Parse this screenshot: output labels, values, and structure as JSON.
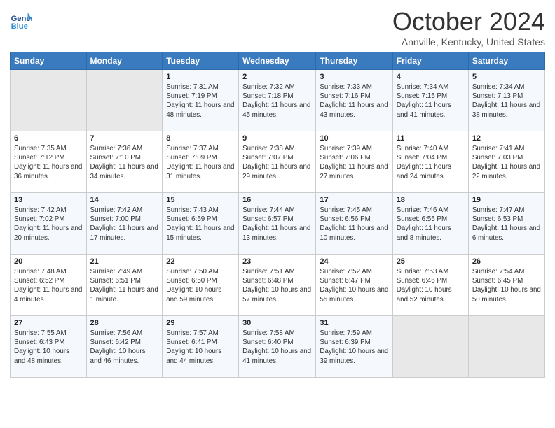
{
  "header": {
    "logo_line1": "General",
    "logo_line2": "Blue",
    "month": "October 2024",
    "location": "Annville, Kentucky, United States"
  },
  "days_of_week": [
    "Sunday",
    "Monday",
    "Tuesday",
    "Wednesday",
    "Thursday",
    "Friday",
    "Saturday"
  ],
  "weeks": [
    [
      {
        "day": "",
        "detail": ""
      },
      {
        "day": "",
        "detail": ""
      },
      {
        "day": "1",
        "detail": "Sunrise: 7:31 AM\nSunset: 7:19 PM\nDaylight: 11 hours and 48 minutes."
      },
      {
        "day": "2",
        "detail": "Sunrise: 7:32 AM\nSunset: 7:18 PM\nDaylight: 11 hours and 45 minutes."
      },
      {
        "day": "3",
        "detail": "Sunrise: 7:33 AM\nSunset: 7:16 PM\nDaylight: 11 hours and 43 minutes."
      },
      {
        "day": "4",
        "detail": "Sunrise: 7:34 AM\nSunset: 7:15 PM\nDaylight: 11 hours and 41 minutes."
      },
      {
        "day": "5",
        "detail": "Sunrise: 7:34 AM\nSunset: 7:13 PM\nDaylight: 11 hours and 38 minutes."
      }
    ],
    [
      {
        "day": "6",
        "detail": "Sunrise: 7:35 AM\nSunset: 7:12 PM\nDaylight: 11 hours and 36 minutes."
      },
      {
        "day": "7",
        "detail": "Sunrise: 7:36 AM\nSunset: 7:10 PM\nDaylight: 11 hours and 34 minutes."
      },
      {
        "day": "8",
        "detail": "Sunrise: 7:37 AM\nSunset: 7:09 PM\nDaylight: 11 hours and 31 minutes."
      },
      {
        "day": "9",
        "detail": "Sunrise: 7:38 AM\nSunset: 7:07 PM\nDaylight: 11 hours and 29 minutes."
      },
      {
        "day": "10",
        "detail": "Sunrise: 7:39 AM\nSunset: 7:06 PM\nDaylight: 11 hours and 27 minutes."
      },
      {
        "day": "11",
        "detail": "Sunrise: 7:40 AM\nSunset: 7:04 PM\nDaylight: 11 hours and 24 minutes."
      },
      {
        "day": "12",
        "detail": "Sunrise: 7:41 AM\nSunset: 7:03 PM\nDaylight: 11 hours and 22 minutes."
      }
    ],
    [
      {
        "day": "13",
        "detail": "Sunrise: 7:42 AM\nSunset: 7:02 PM\nDaylight: 11 hours and 20 minutes."
      },
      {
        "day": "14",
        "detail": "Sunrise: 7:42 AM\nSunset: 7:00 PM\nDaylight: 11 hours and 17 minutes."
      },
      {
        "day": "15",
        "detail": "Sunrise: 7:43 AM\nSunset: 6:59 PM\nDaylight: 11 hours and 15 minutes."
      },
      {
        "day": "16",
        "detail": "Sunrise: 7:44 AM\nSunset: 6:57 PM\nDaylight: 11 hours and 13 minutes."
      },
      {
        "day": "17",
        "detail": "Sunrise: 7:45 AM\nSunset: 6:56 PM\nDaylight: 11 hours and 10 minutes."
      },
      {
        "day": "18",
        "detail": "Sunrise: 7:46 AM\nSunset: 6:55 PM\nDaylight: 11 hours and 8 minutes."
      },
      {
        "day": "19",
        "detail": "Sunrise: 7:47 AM\nSunset: 6:53 PM\nDaylight: 11 hours and 6 minutes."
      }
    ],
    [
      {
        "day": "20",
        "detail": "Sunrise: 7:48 AM\nSunset: 6:52 PM\nDaylight: 11 hours and 4 minutes."
      },
      {
        "day": "21",
        "detail": "Sunrise: 7:49 AM\nSunset: 6:51 PM\nDaylight: 11 hours and 1 minute."
      },
      {
        "day": "22",
        "detail": "Sunrise: 7:50 AM\nSunset: 6:50 PM\nDaylight: 10 hours and 59 minutes."
      },
      {
        "day": "23",
        "detail": "Sunrise: 7:51 AM\nSunset: 6:48 PM\nDaylight: 10 hours and 57 minutes."
      },
      {
        "day": "24",
        "detail": "Sunrise: 7:52 AM\nSunset: 6:47 PM\nDaylight: 10 hours and 55 minutes."
      },
      {
        "day": "25",
        "detail": "Sunrise: 7:53 AM\nSunset: 6:46 PM\nDaylight: 10 hours and 52 minutes."
      },
      {
        "day": "26",
        "detail": "Sunrise: 7:54 AM\nSunset: 6:45 PM\nDaylight: 10 hours and 50 minutes."
      }
    ],
    [
      {
        "day": "27",
        "detail": "Sunrise: 7:55 AM\nSunset: 6:43 PM\nDaylight: 10 hours and 48 minutes."
      },
      {
        "day": "28",
        "detail": "Sunrise: 7:56 AM\nSunset: 6:42 PM\nDaylight: 10 hours and 46 minutes."
      },
      {
        "day": "29",
        "detail": "Sunrise: 7:57 AM\nSunset: 6:41 PM\nDaylight: 10 hours and 44 minutes."
      },
      {
        "day": "30",
        "detail": "Sunrise: 7:58 AM\nSunset: 6:40 PM\nDaylight: 10 hours and 41 minutes."
      },
      {
        "day": "31",
        "detail": "Sunrise: 7:59 AM\nSunset: 6:39 PM\nDaylight: 10 hours and 39 minutes."
      },
      {
        "day": "",
        "detail": ""
      },
      {
        "day": "",
        "detail": ""
      }
    ]
  ]
}
